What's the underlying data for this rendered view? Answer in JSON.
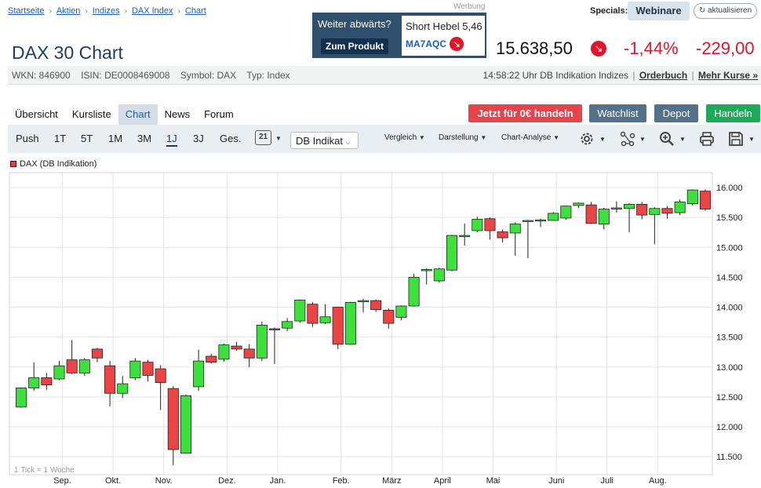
{
  "breadcrumb": [
    "Startseite",
    "Aktien",
    "Indizes",
    "DAX Index",
    "Chart"
  ],
  "ad": {
    "label": "Werbung",
    "headline": "Weiter abwärts?",
    "button": "Zum Produkt",
    "product": "Short Hebel 5,46",
    "wkn": "MA7AQC",
    "arrow_icon": "↘"
  },
  "specials": {
    "label": "Specials:",
    "webinare": "Webinare",
    "refresh": "↻ aktualisieren"
  },
  "quote": {
    "title": "DAX 30 Chart",
    "price": "15.638,50",
    "change_pct": "-1,44%",
    "change_abs": "-229,00",
    "down_color": "#e2132b"
  },
  "info": {
    "wkn": "WKN: 846900",
    "isin": "ISIN: DE0008469008",
    "symbol": "Symbol: DAX",
    "typ": "Typ: Index",
    "time": "14:58:22 Uhr DB Indikation Indizes",
    "orderbuch": "Orderbuch",
    "mehr_kurse": "Mehr Kurse »"
  },
  "tabs": [
    "Übersicht",
    "Kursliste",
    "Chart",
    "News",
    "Forum"
  ],
  "active_tab": "Chart",
  "actions": {
    "trade_free": "Jetzt für 0€ handeln",
    "watchlist": "Watchlist",
    "depot": "Depot",
    "handeln": "Handeln"
  },
  "toolbar": {
    "periods": [
      "Push",
      "1T",
      "5T",
      "1M",
      "3M",
      "1J",
      "3J",
      "Ges."
    ],
    "active_period": "1J",
    "calendar_day": "21",
    "source_select": "DB Indikat",
    "menus": [
      "Vergleich",
      "Darstellung",
      "Chart-Analyse"
    ],
    "icons": [
      "gear-icon",
      "network-icon",
      "zoom-icon",
      "print-icon",
      "save-icon"
    ]
  },
  "chart_data": {
    "type": "candlestick",
    "legend": "DAX (DB Indikation)",
    "tick_note": "1 Tick = 1 Woche",
    "ylim": [
      11200,
      16250
    ],
    "yticks": [
      11500,
      12000,
      12500,
      13000,
      13500,
      14000,
      14500,
      15000,
      15500,
      16000
    ],
    "ytick_labels": [
      "11.500",
      "12.000",
      "12.500",
      "13.000",
      "13.500",
      "14.000",
      "14.500",
      "15.000",
      "15.500",
      "16.000"
    ],
    "xlabels": [
      "Sep.",
      "Okt.",
      "Nov.",
      "Dez.",
      "Jan.",
      "Feb.",
      "März",
      "April",
      "Mai",
      "Juni",
      "Juli",
      "Aug."
    ],
    "xlabel_week_index": [
      4,
      8,
      12,
      17,
      21,
      26,
      30,
      34,
      38,
      43,
      47,
      51
    ],
    "up_color": "#3ee03e",
    "down_color": "#ea4444",
    "candles": [
      [
        12330,
        12650,
        12320,
        12660
      ],
      [
        12650,
        12820,
        12600,
        13080
      ],
      [
        12820,
        12700,
        12620,
        12900
      ],
      [
        12800,
        13020,
        12780,
        13100
      ],
      [
        13120,
        12900,
        12880,
        13450
      ],
      [
        12900,
        13120,
        12850,
        13150
      ],
      [
        13300,
        13150,
        13080,
        13320
      ],
      [
        13020,
        12560,
        12340,
        13100
      ],
      [
        12560,
        12720,
        12480,
        12850
      ],
      [
        12820,
        13100,
        12780,
        13150
      ],
      [
        13080,
        12860,
        12760,
        13120
      ],
      [
        12970,
        12740,
        12280,
        13030
      ],
      [
        12640,
        11620,
        11360,
        12680
      ],
      [
        11560,
        12520,
        11550,
        12540
      ],
      [
        12670,
        13100,
        12600,
        13290
      ],
      [
        13180,
        13080,
        13060,
        13220
      ],
      [
        13130,
        13370,
        13090,
        13390
      ],
      [
        13350,
        13300,
        13270,
        13420
      ],
      [
        13300,
        13150,
        13000,
        13380
      ],
      [
        13150,
        13700,
        13100,
        13760
      ],
      [
        13640,
        13630,
        13050,
        13660
      ],
      [
        13650,
        13760,
        13600,
        13820
      ],
      [
        13770,
        14120,
        13740,
        14130
      ],
      [
        14050,
        13730,
        13670,
        14080
      ],
      [
        13740,
        13840,
        13720,
        14050
      ],
      [
        14000,
        13380,
        13300,
        14010
      ],
      [
        13380,
        14080,
        13370,
        14090
      ],
      [
        14090,
        14110,
        13910,
        14140
      ],
      [
        14110,
        13960,
        13920,
        14130
      ],
      [
        13950,
        13730,
        13640,
        13980
      ],
      [
        13830,
        14020,
        13780,
        14030
      ],
      [
        14020,
        14500,
        14010,
        14560
      ],
      [
        14620,
        14630,
        14380,
        14650
      ],
      [
        14440,
        14640,
        14410,
        14660
      ],
      [
        14620,
        15200,
        14600,
        15210
      ],
      [
        15180,
        15200,
        15030,
        15400
      ],
      [
        15280,
        15470,
        15250,
        15510
      ],
      [
        15480,
        15280,
        15130,
        15500
      ],
      [
        15260,
        15160,
        15080,
        15300
      ],
      [
        15240,
        15390,
        14860,
        15420
      ],
      [
        15440,
        15450,
        14820,
        15460
      ],
      [
        15440,
        15460,
        15340,
        15480
      ],
      [
        15450,
        15570,
        15450,
        15590
      ],
      [
        15490,
        15690,
        15460,
        15700
      ],
      [
        15700,
        15740,
        15660,
        15750
      ],
      [
        15710,
        15400,
        15390,
        15760
      ],
      [
        15390,
        15640,
        15300,
        15660
      ],
      [
        15640,
        15660,
        15580,
        15770
      ],
      [
        15650,
        15720,
        15250,
        15740
      ],
      [
        15720,
        15540,
        15470,
        15760
      ],
      [
        15550,
        15650,
        15050,
        15670
      ],
      [
        15650,
        15570,
        15480,
        15690
      ],
      [
        15580,
        15760,
        15540,
        15800
      ],
      [
        15730,
        15960,
        15700,
        15970
      ],
      [
        15940,
        15640,
        15610,
        15970
      ]
    ]
  }
}
